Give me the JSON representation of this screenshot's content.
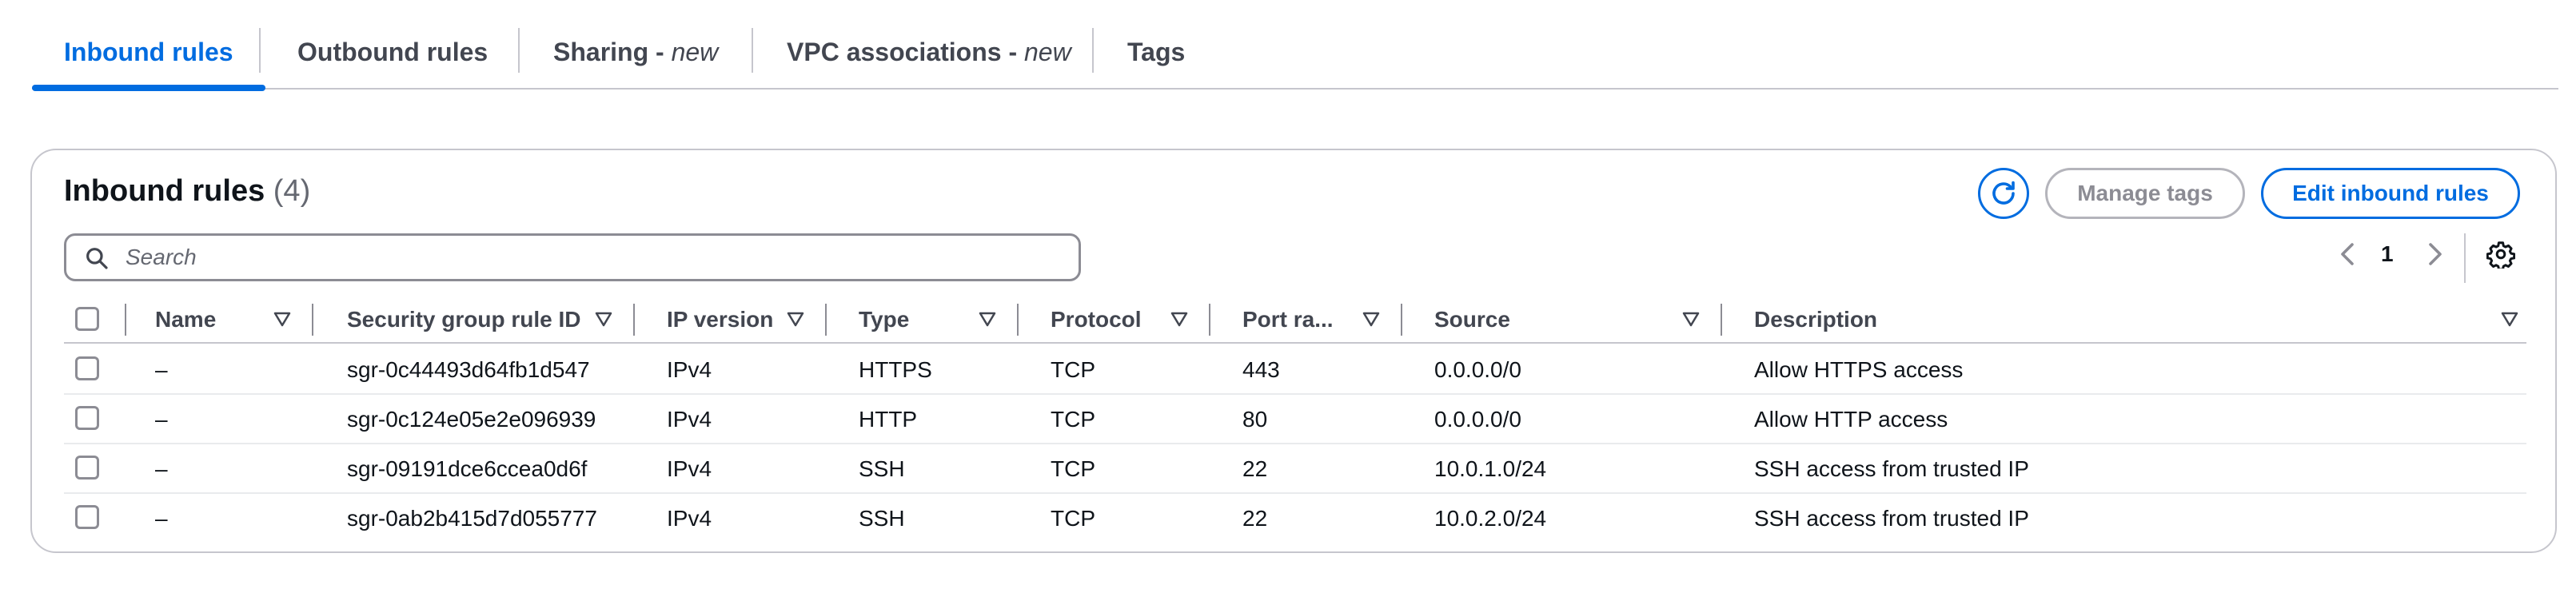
{
  "tabs": [
    {
      "label": "Inbound rules",
      "suffix": ""
    },
    {
      "label": "Outbound rules",
      "suffix": ""
    },
    {
      "label": "Sharing - ",
      "suffix": "new"
    },
    {
      "label": "VPC associations - ",
      "suffix": "new"
    },
    {
      "label": "Tags",
      "suffix": ""
    }
  ],
  "panel": {
    "title": "Inbound rules",
    "count": "(4)",
    "manage_tags_label": "Manage tags",
    "edit_rules_label": "Edit inbound rules",
    "search_placeholder": "Search",
    "search_value": "",
    "page_number": "1"
  },
  "columns": [
    "Name",
    "Security group rule ID",
    "IP version",
    "Type",
    "Protocol",
    "Port ra...",
    "Source",
    "Description"
  ],
  "rows": [
    {
      "name": "–",
      "rule_id": "sgr-0c44493d64fb1d547",
      "ip_version": "IPv4",
      "type": "HTTPS",
      "protocol": "TCP",
      "port": "443",
      "source": "0.0.0.0/0",
      "description": "Allow HTTPS access"
    },
    {
      "name": "–",
      "rule_id": "sgr-0c124e05e2e096939",
      "ip_version": "IPv4",
      "type": "HTTP",
      "protocol": "TCP",
      "port": "80",
      "source": "0.0.0.0/0",
      "description": "Allow HTTP access"
    },
    {
      "name": "–",
      "rule_id": "sgr-09191dce6ccea0d6f",
      "ip_version": "IPv4",
      "type": "SSH",
      "protocol": "TCP",
      "port": "22",
      "source": "10.0.1.0/24",
      "description": "SSH access from trusted IP"
    },
    {
      "name": "–",
      "rule_id": "sgr-0ab2b415d7d055777",
      "ip_version": "IPv4",
      "type": "SSH",
      "protocol": "TCP",
      "port": "22",
      "source": "10.0.2.0/24",
      "description": "SSH access from trusted IP"
    }
  ],
  "icons": {
    "refresh": "refresh-icon",
    "search": "search-icon",
    "prev": "chevron-left-icon",
    "next": "chevron-right-icon",
    "settings": "gear-icon",
    "sort": "sort-caret-icon"
  },
  "colors": {
    "accent": "#006ce0",
    "text": "#0f141a",
    "muted": "#424650",
    "border": "#c6c6cd",
    "disabled": "#8c8c94"
  }
}
